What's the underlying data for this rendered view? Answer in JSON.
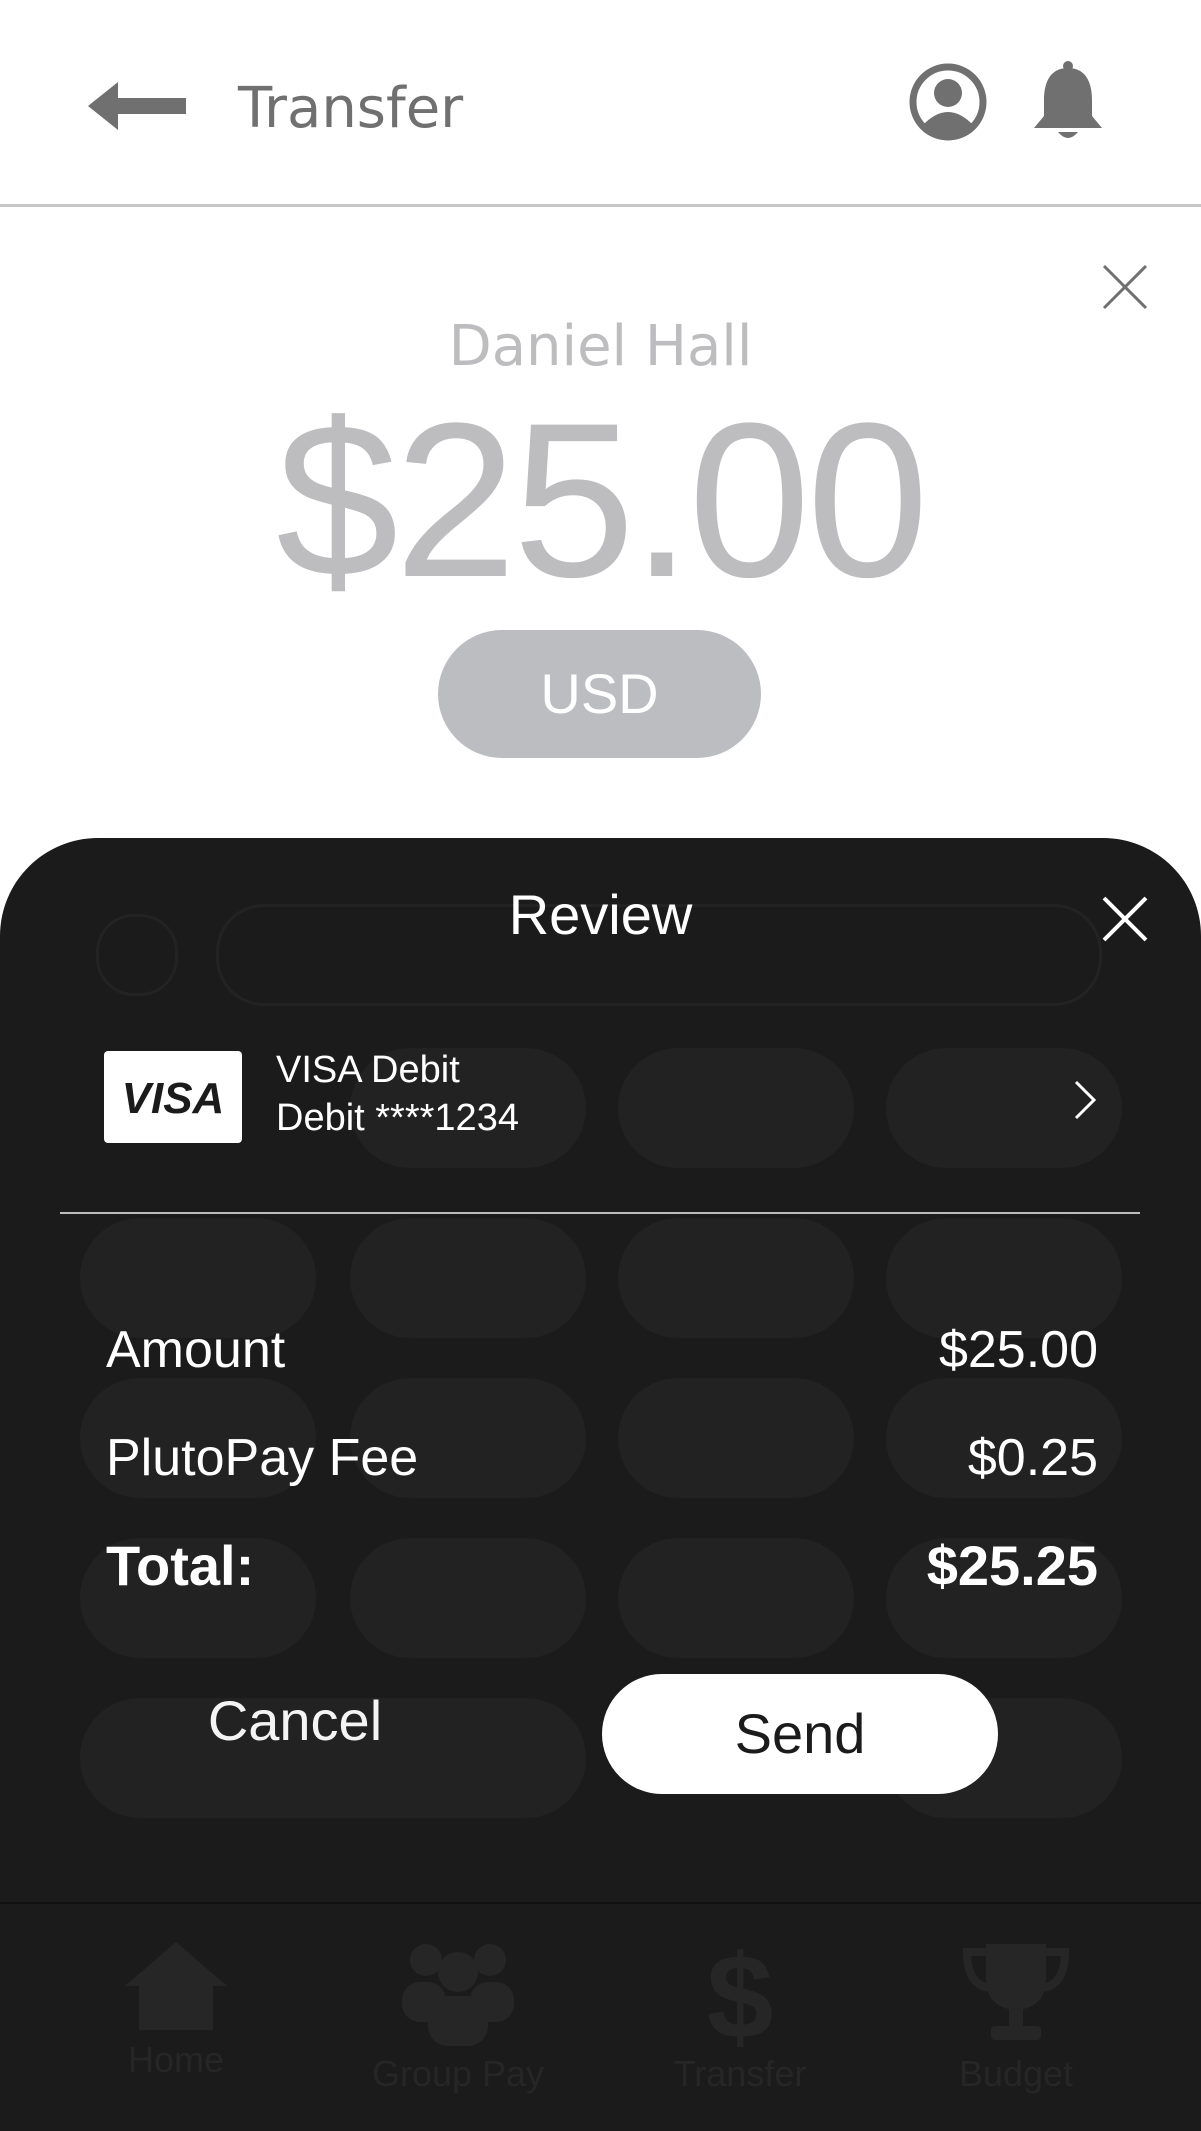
{
  "header": {
    "title": "Transfer",
    "back_icon": "arrow-left-icon",
    "account_icon": "account-icon",
    "notification_icon": "bell-icon"
  },
  "transfer": {
    "recipient": "Daniel Hall",
    "amount": "$25.00",
    "currency": "USD"
  },
  "review": {
    "title": "Review",
    "card": {
      "brand": "VISA",
      "name": "VISA Debit",
      "number": "Debit ****1234"
    },
    "rows": [
      {
        "label": "Amount",
        "value": "$25.00"
      },
      {
        "label": "PlutoPay Fee",
        "value": "$0.25"
      },
      {
        "label": "Total:",
        "value": "$25.25"
      }
    ],
    "cancel_label": "Cancel",
    "send_label": "Send"
  },
  "nav": {
    "items": [
      {
        "label": "Home",
        "icon": "home-icon"
      },
      {
        "label": "Group Pay",
        "icon": "group-icon"
      },
      {
        "label": "Transfer",
        "icon": "dollar-icon"
      },
      {
        "label": "Budget",
        "icon": "trophy-icon"
      }
    ]
  },
  "colors": {
    "sheet": "#1b1b1b",
    "muted": "#bdbdc0",
    "header_text": "#707070"
  }
}
